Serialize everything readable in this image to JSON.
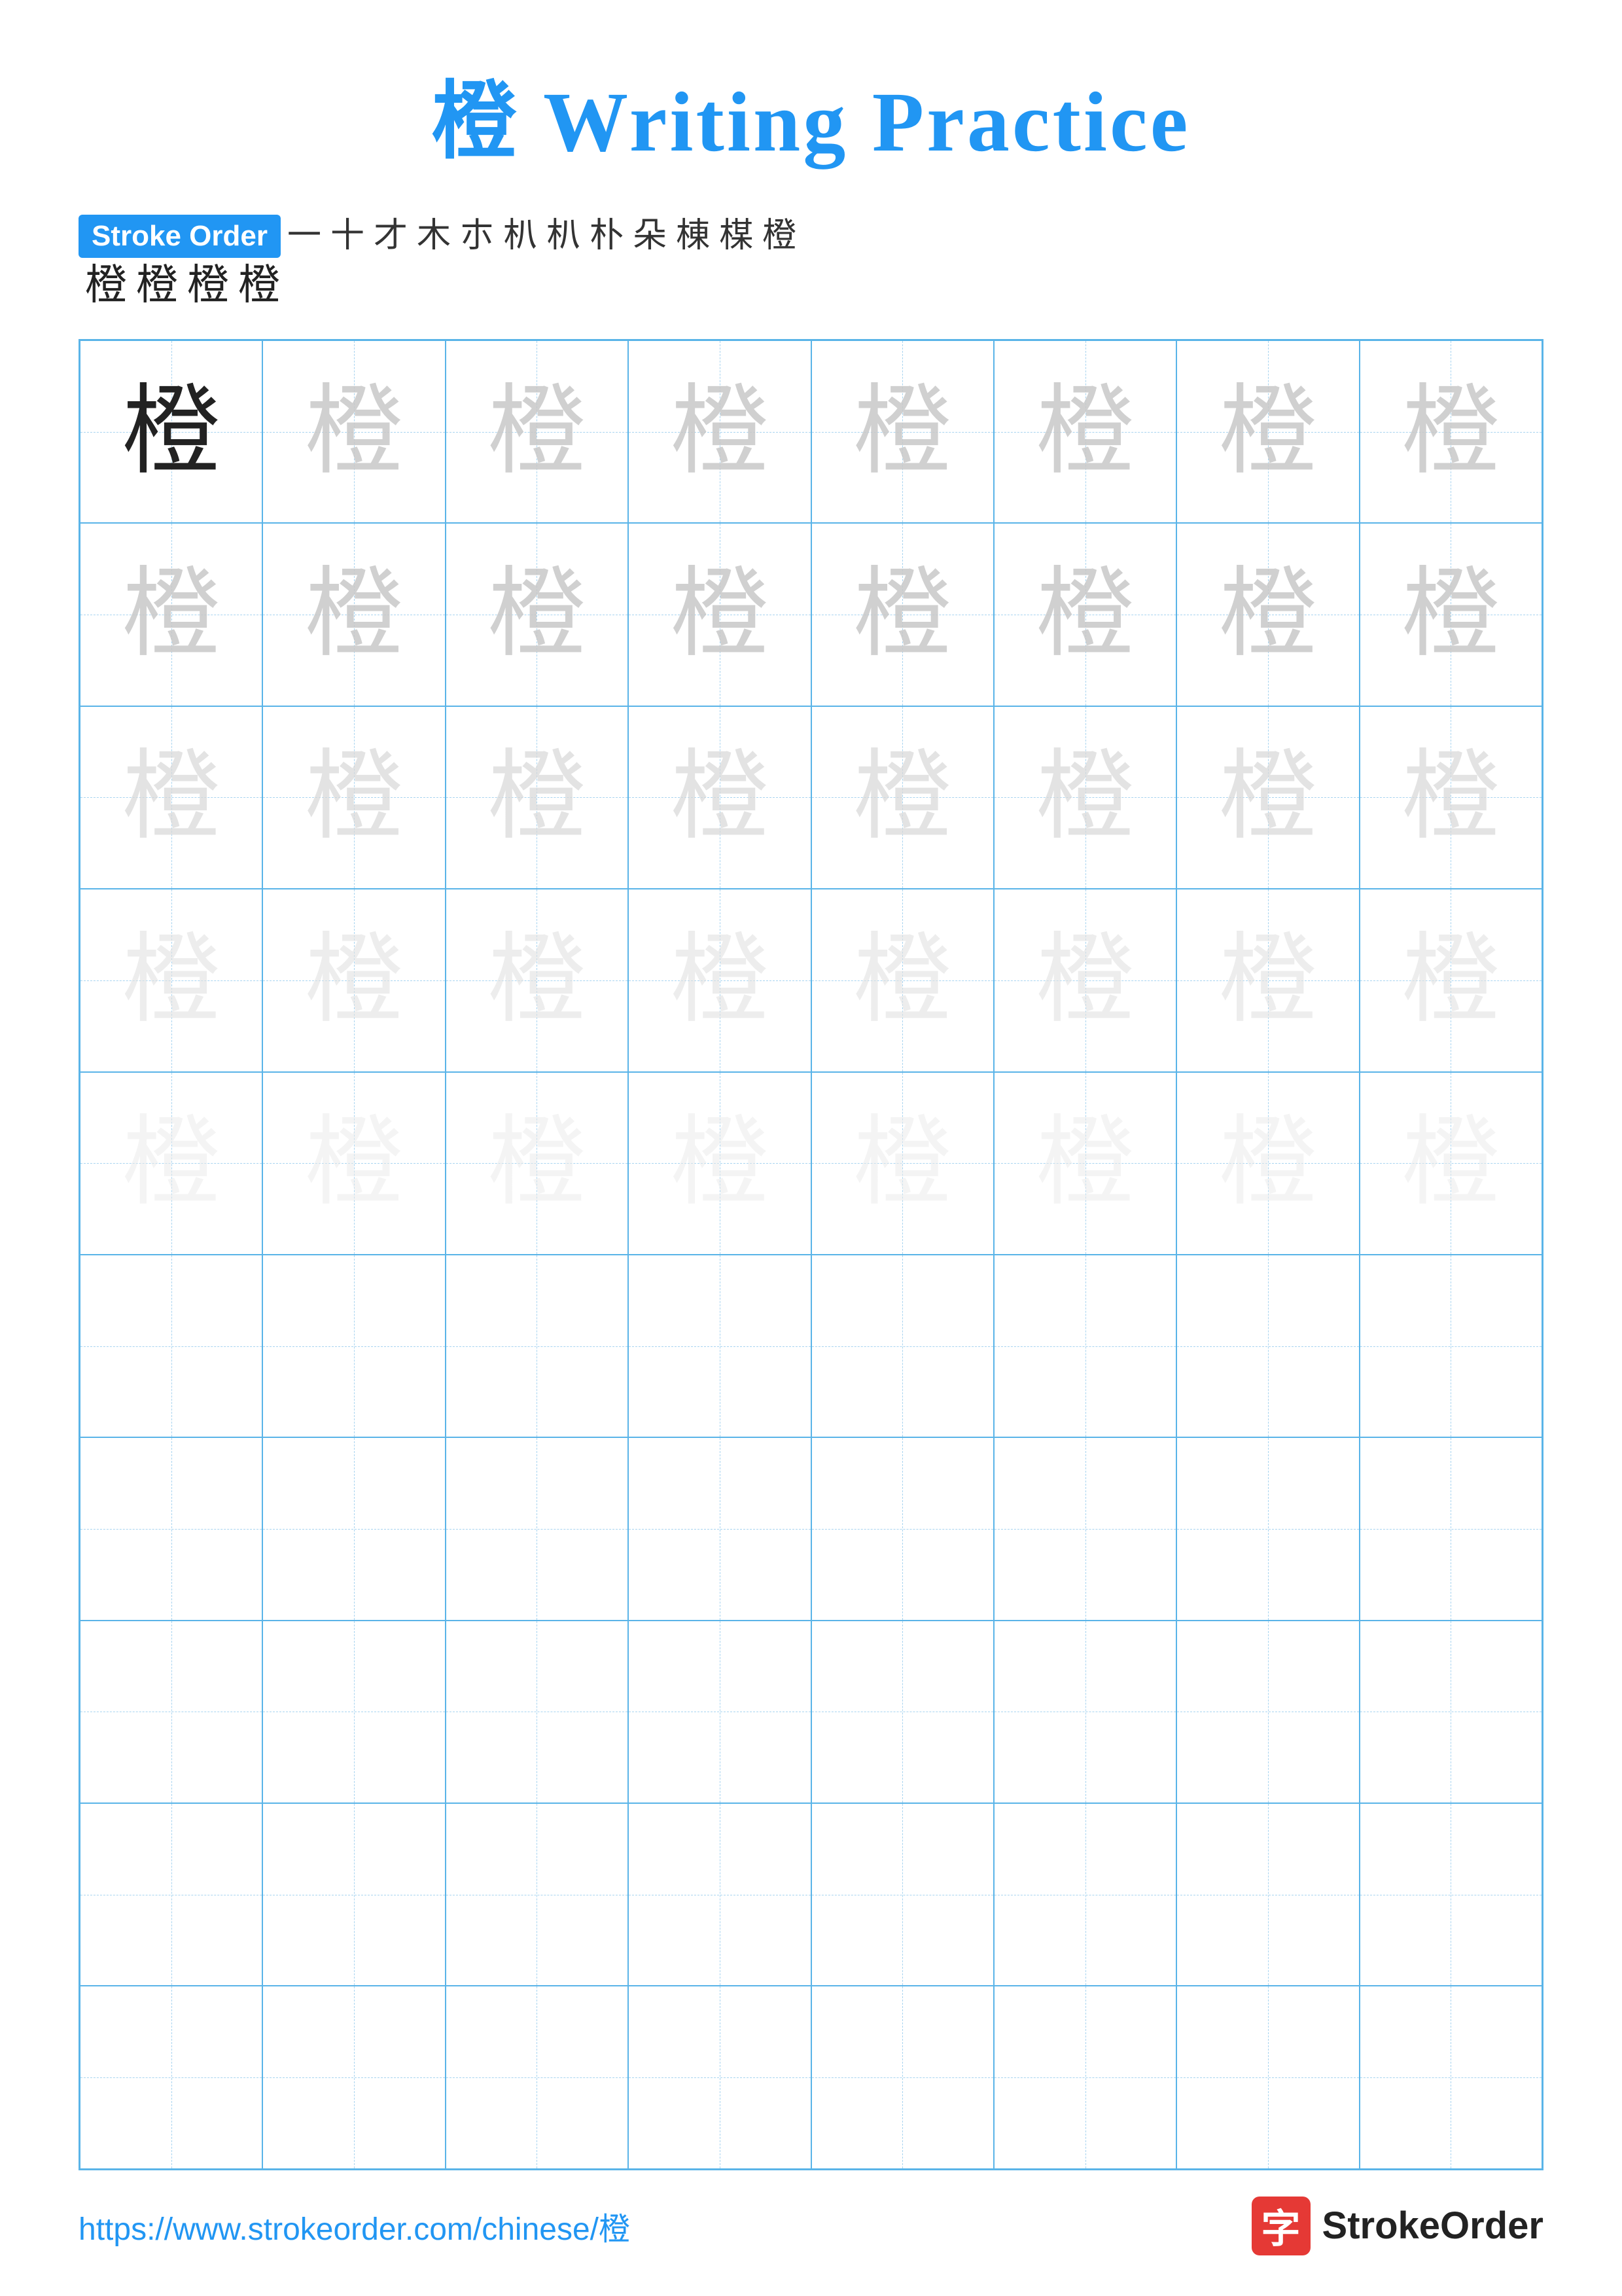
{
  "title": {
    "char": "橙",
    "text": " Writing Practice"
  },
  "stroke_order": {
    "badge_label": "Stroke Order",
    "row1_chars": [
      "一",
      "十",
      "才",
      "木",
      "朩",
      "朳",
      "朳",
      "朴",
      "朵",
      "棟",
      "楳",
      "橙"
    ],
    "row2_chars": [
      "橙",
      "橙",
      "橙",
      "橙"
    ]
  },
  "practice": {
    "character": "橙",
    "rows": 10,
    "cols": 8,
    "shading_rows": [
      [
        0,
        1,
        1,
        1,
        1,
        1,
        1,
        1
      ],
      [
        2,
        2,
        2,
        2,
        2,
        2,
        2,
        2
      ],
      [
        3,
        3,
        3,
        3,
        3,
        3,
        3,
        3
      ],
      [
        4,
        4,
        4,
        4,
        4,
        4,
        4,
        4
      ],
      [
        5,
        5,
        5,
        5,
        5,
        5,
        5,
        5
      ],
      [
        6,
        6,
        6,
        6,
        6,
        6,
        6,
        6
      ],
      [
        6,
        6,
        6,
        6,
        6,
        6,
        6,
        6
      ],
      [
        6,
        6,
        6,
        6,
        6,
        6,
        6,
        6
      ],
      [
        6,
        6,
        6,
        6,
        6,
        6,
        6,
        6
      ],
      [
        6,
        6,
        6,
        6,
        6,
        6,
        6,
        6
      ]
    ]
  },
  "footer": {
    "url": "https://www.strokeorder.com/chinese/橙",
    "logo_char": "字",
    "logo_text": "StrokeOrder"
  }
}
